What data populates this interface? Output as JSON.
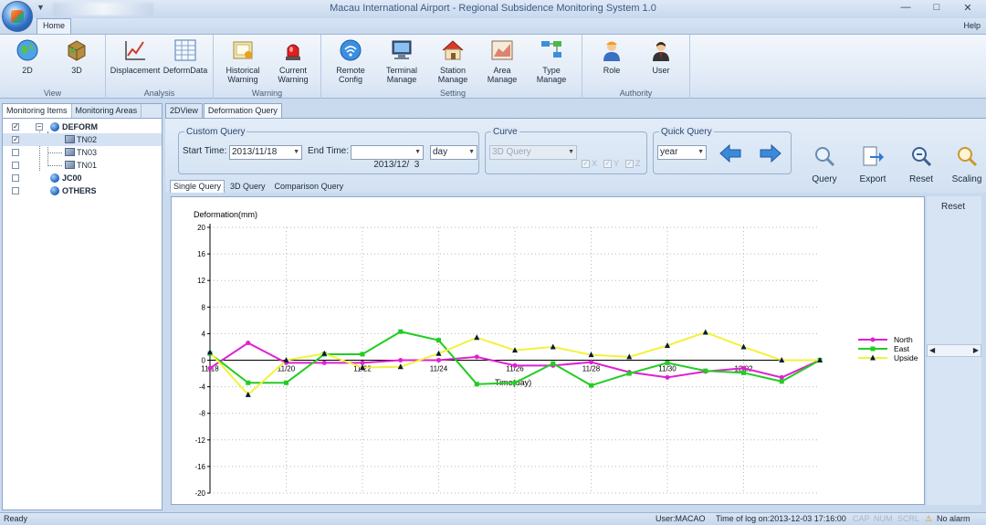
{
  "window": {
    "title": "Macau International Airport - Regional Subsidence Monitoring System 1.0",
    "buttons": [
      "—",
      "□",
      "✕"
    ]
  },
  "tabs": {
    "home": "Home",
    "help": "Help"
  },
  "ribbon": {
    "view": {
      "label": "View",
      "buttons": [
        "2D",
        "3D"
      ]
    },
    "analysis": {
      "label": "Analysis",
      "buttons": [
        "Displacement",
        "DeformData"
      ]
    },
    "warning": {
      "label": "Warning",
      "buttons": [
        [
          "Historical",
          "Warning"
        ],
        [
          "Current",
          "Warning"
        ]
      ]
    },
    "setting": {
      "label": "Setting",
      "buttons": [
        [
          "Remote",
          "Config"
        ],
        [
          "Terminal",
          "Manage"
        ],
        [
          "Station",
          "Manage"
        ],
        [
          "Area",
          "Manage"
        ],
        [
          "Type",
          "Manage"
        ]
      ]
    },
    "authority": {
      "label": "Authority",
      "buttons": [
        "Role",
        "User"
      ]
    }
  },
  "left_panel": {
    "tabs": [
      "Monitoring Items",
      "Monitoring Areas"
    ],
    "tree": [
      {
        "label": "DEFORM",
        "checked": true,
        "expander": "−"
      },
      {
        "label": "TN02",
        "checked": true
      },
      {
        "label": "TN03",
        "checked": false
      },
      {
        "label": "TN01",
        "checked": false
      },
      {
        "label": "JC00",
        "checked": false
      },
      {
        "label": "OTHERS",
        "checked": false
      }
    ],
    "check_mark": "✓"
  },
  "main": {
    "tabs": [
      "2DView",
      "Deformation Query"
    ],
    "custom_query": {
      "legend": "Custom Query",
      "start_label": "Start Time:",
      "start_value": "2013/11/18",
      "end_label": "End Time:",
      "end_value": "2013/12/  3",
      "unit_value": "day"
    },
    "curve": {
      "legend": "Curve",
      "combo_value": "3D Query",
      "checks": [
        "X",
        "Y",
        "Z"
      ]
    },
    "quick_query": {
      "legend": "Quick Query",
      "value": "year"
    },
    "toolbar": [
      "Query",
      "Export",
      "Reset",
      "Scaling"
    ],
    "subtabs": [
      "Single Query",
      "3D Query",
      "Comparison Query"
    ],
    "right_reset": "Reset"
  },
  "status": {
    "left": "Ready",
    "user": "User:MACAO",
    "logon": "Time of log on:2013-12-03 17:16:00",
    "caps": "CAP",
    "num": "NUM",
    "scrl": "SCRL",
    "alarm": "No alarm"
  },
  "chart_data": {
    "type": "line",
    "ylabel": "Deformation(mm)",
    "xlabel": "Time(day)",
    "ylim": [
      -20,
      20
    ],
    "yticks": [
      20,
      16,
      12,
      8,
      4,
      0,
      -4,
      -8,
      -12,
      -16,
      -20
    ],
    "xlabels": [
      "11/18",
      "11/20",
      "11/22",
      "11/24",
      "11/26",
      "11/28",
      "11/30",
      "12/02"
    ],
    "x": [
      18,
      19,
      20,
      21,
      22,
      23,
      24,
      25,
      26,
      27,
      28,
      29,
      30,
      31,
      32,
      33,
      34
    ],
    "grid": true,
    "legend_position": "right",
    "series": [
      {
        "name": "North",
        "color": "#e020d0",
        "marker": "circle",
        "values": [
          -1.2,
          2.6,
          -0.4,
          -0.4,
          -0.4,
          0.0,
          0.0,
          0.5,
          -0.8,
          -0.8,
          -0.3,
          -1.8,
          -2.6,
          -1.7,
          -1.2,
          -2.6,
          0.0
        ]
      },
      {
        "name": "East",
        "color": "#22cc22",
        "marker": "square",
        "values": [
          1.0,
          -3.4,
          -3.4,
          0.9,
          0.9,
          4.3,
          3.0,
          -3.6,
          -3.4,
          -0.5,
          -3.8,
          -2.0,
          -0.4,
          -1.6,
          -1.9,
          -3.2,
          0.0
        ]
      },
      {
        "name": "Upside",
        "color": "#f2f23a",
        "marker": "triangle",
        "values": [
          1.2,
          -5.2,
          0.0,
          1.0,
          -1.1,
          -1.0,
          1.0,
          3.4,
          1.5,
          2.0,
          0.8,
          0.5,
          2.2,
          4.2,
          2.0,
          0.0,
          0.0
        ]
      }
    ]
  }
}
